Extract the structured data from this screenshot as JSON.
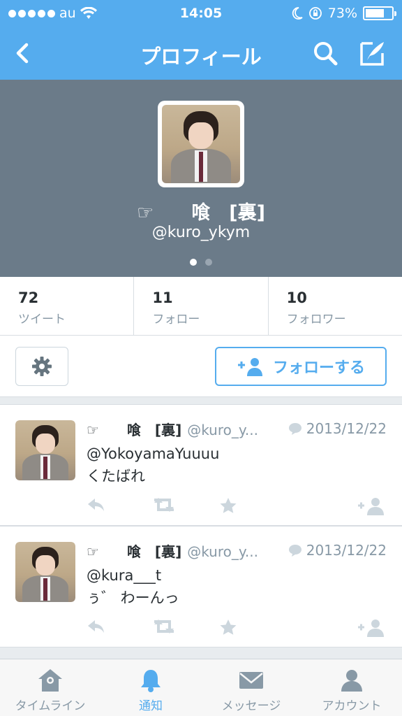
{
  "status_bar": {
    "carrier": "au",
    "time": "14:05",
    "battery": "73%",
    "battery_level": 0.73
  },
  "nav": {
    "title": "プロフィール"
  },
  "profile": {
    "display_name": "☞　　喰　[裏]",
    "handle": "@kuro_ykym"
  },
  "stats": [
    {
      "count": "72",
      "label": "ツイート"
    },
    {
      "count": "11",
      "label": "フォロー"
    },
    {
      "count": "10",
      "label": "フォロワー"
    }
  ],
  "follow_button": {
    "label": "フォローする"
  },
  "tweets": [
    {
      "name": "☞　　喰　[裏]",
      "handle": "@kuro_y...",
      "date": "2013/12/22",
      "mention": "@YokoyamaYuuuu",
      "text": "くたばれ"
    },
    {
      "name": "☞　　喰　[裏]",
      "handle": "@kuro_y...",
      "date": "2013/12/22",
      "mention": "@kura___t",
      "text": "ぅ゛ わーんっ"
    }
  ],
  "tabs": [
    {
      "label": "タイムライン",
      "icon": "home-icon",
      "active": false
    },
    {
      "label": "通知",
      "icon": "bell-icon",
      "active": true
    },
    {
      "label": "メッセージ",
      "icon": "envelope-icon",
      "active": false
    },
    {
      "label": "アカウント",
      "icon": "person-icon",
      "active": false
    }
  ],
  "colors": {
    "brand": "#55acee",
    "header_bg": "#6b7b89",
    "muted": "#8899a6",
    "text": "#292f33"
  }
}
